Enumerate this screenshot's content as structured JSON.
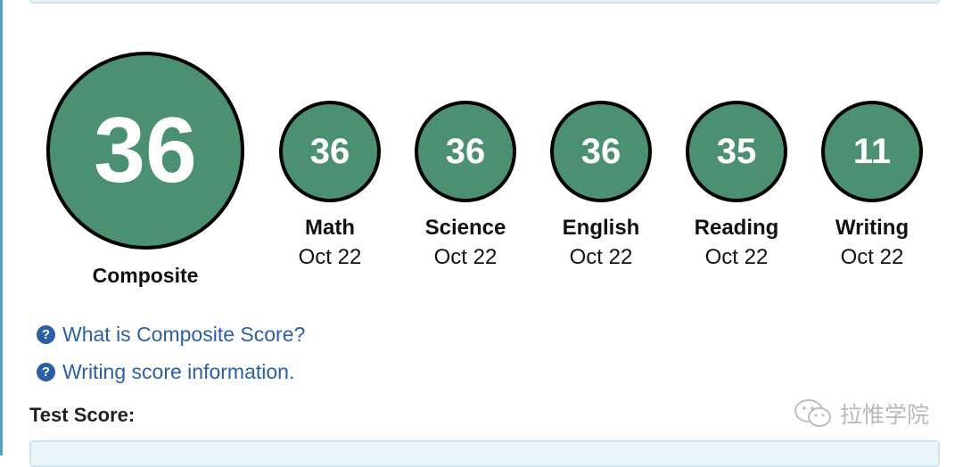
{
  "composite": {
    "score": "36",
    "label": "Composite"
  },
  "subscores": [
    {
      "score": "36",
      "label": "Math",
      "date": "Oct 22"
    },
    {
      "score": "36",
      "label": "Science",
      "date": "Oct 22"
    },
    {
      "score": "36",
      "label": "English",
      "date": "Oct 22"
    },
    {
      "score": "35",
      "label": "Reading",
      "date": "Oct 22"
    },
    {
      "score": "11",
      "label": "Writing",
      "date": "Oct 22"
    }
  ],
  "links": {
    "composite_info": "What is Composite Score?",
    "writing_info": "Writing score information."
  },
  "help_icon_glyph": "?",
  "section": {
    "test_score_heading": "Test Score:"
  },
  "watermark": {
    "text": "拉惟学院",
    "icon": "wechat-icon"
  },
  "colors": {
    "circle_fill": "#4b9071",
    "link": "#2a5fa8",
    "panel": "#eaf5fa"
  }
}
